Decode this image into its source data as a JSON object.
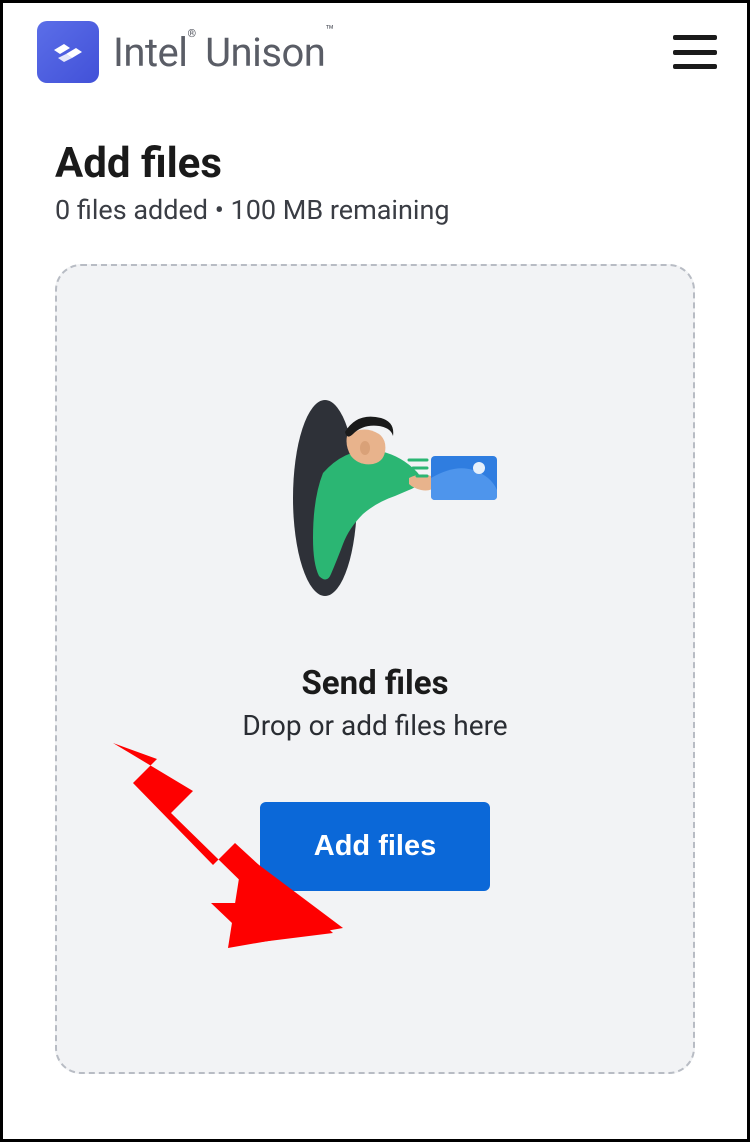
{
  "header": {
    "brand_first": "Intel",
    "brand_second": "Unison",
    "reg_symbol": "®",
    "tm_symbol": "™"
  },
  "page": {
    "title": "Add files",
    "subtitle": "0 files added • 100 MB remaining"
  },
  "dropzone": {
    "title": "Send files",
    "subtitle": "Drop or add files here",
    "button_label": "Add files"
  },
  "colors": {
    "primary_button": "#0b68d8",
    "logo_gradient_start": "#5b6ee8",
    "logo_gradient_end": "#4251d8",
    "dropzone_bg": "#f2f3f5",
    "arrow": "#fe0000"
  }
}
